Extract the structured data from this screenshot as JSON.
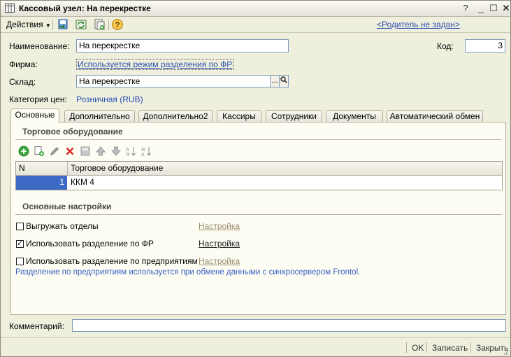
{
  "window": {
    "title": "Кассовый узел: На перекрестке"
  },
  "toolbar": {
    "actions_label": "Действия",
    "parent_link": "<Родитель не задан>"
  },
  "form": {
    "name_label": "Наименование:",
    "name_value": "На перекрестке",
    "code_label": "Код:",
    "code_value": "3",
    "firm_label": "Фирма:",
    "firm_value": "Используется режим разделения по ФР",
    "warehouse_label": "Склад:",
    "warehouse_value": "На перекрестке",
    "warehouse_select": "...",
    "price_label": "Категория цен:",
    "price_value": "Розничная (RUB)"
  },
  "tabs": [
    "Основные",
    "Дополнительно",
    "Дополнительно2",
    "Кассиры",
    "Сотрудники",
    "Документы",
    "Автоматический обмен"
  ],
  "equipment": {
    "title": "Торговое оборудование",
    "columns": [
      "N",
      "Торговое оборудование"
    ],
    "rows": [
      {
        "n": "1",
        "name": "ККМ 4"
      }
    ]
  },
  "settings": {
    "title": "Основные настройки",
    "items": [
      {
        "label": "Выгружать отделы",
        "checked": false,
        "link": "Настройка"
      },
      {
        "label": "Использовать разделение по ФР",
        "checked": true,
        "link": "Настройка"
      },
      {
        "label": "Использовать разделение по предприятиям",
        "checked": false,
        "link": "Настройка"
      }
    ],
    "note": "Разделение по предприятиям используется при обмене данными с синхросервером Frontol."
  },
  "comment": {
    "label": "Комментарий:",
    "value": ""
  },
  "footer": {
    "ok": "OK",
    "save": "Записать",
    "close": "Закрыть"
  },
  "colors": {
    "accent_link": "#2a50b0",
    "selection": "#3d6ac5",
    "background": "#efefde"
  },
  "icons": [
    "table-icon",
    "minimize-icon",
    "maximize-icon",
    "close-icon",
    "add-icon",
    "copy-icon",
    "edit-icon",
    "delete-icon",
    "move-up-icon",
    "move-down-icon",
    "sort-asc-icon",
    "sort-desc-icon",
    "help-icon",
    "search-icon"
  ]
}
